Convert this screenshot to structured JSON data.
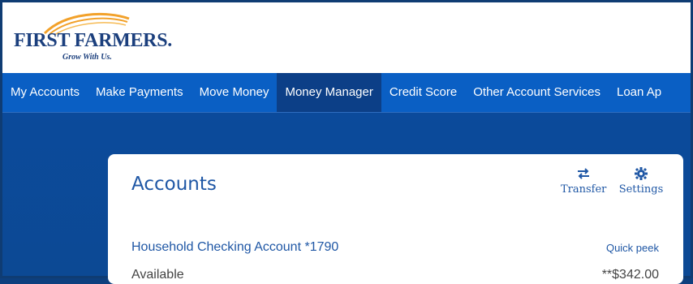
{
  "brand": {
    "name": "FIRST FARMERS.",
    "tagline": "Grow With Us.",
    "arc_color": "#f2a12a"
  },
  "nav": {
    "items": [
      {
        "label": "My Accounts",
        "active": false
      },
      {
        "label": "Make Payments",
        "active": false
      },
      {
        "label": "Move Money",
        "active": false
      },
      {
        "label": "Money Manager",
        "active": true
      },
      {
        "label": "Credit Score",
        "active": false
      },
      {
        "label": "Other Account Services",
        "active": false
      },
      {
        "label": "Loan Ap",
        "active": false
      }
    ],
    "bar_color": "#0a5fc4",
    "active_color": "#0c3f87"
  },
  "card": {
    "title": "Accounts",
    "actions": {
      "transfer": {
        "label": "Transfer",
        "icon": "swap-arrows-icon"
      },
      "settings": {
        "label": "Settings",
        "icon": "gear-icon"
      }
    },
    "account": {
      "name": "Household Checking Account  *1790",
      "quick_peek": "Quick peek",
      "available_label": "Available",
      "available_value": "**$342.00"
    }
  }
}
